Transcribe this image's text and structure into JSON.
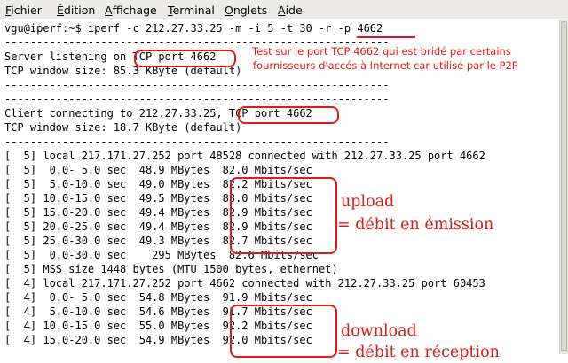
{
  "menubar": {
    "items": [
      {
        "first": "F",
        "rest": "ichier"
      },
      {
        "first": "É",
        "rest": "dition"
      },
      {
        "first": "A",
        "rest": "ffichage"
      },
      {
        "first": "T",
        "rest": "erminal"
      },
      {
        "first": "O",
        "rest": "nglets"
      },
      {
        "first": "A",
        "rest": "ide"
      }
    ]
  },
  "terminal": {
    "lines": [
      "vgu@iperf:~$ iperf -c 212.27.33.25 -m -i 5 -t 30 -r -p 4662",
      "------------------------------------------------------------",
      "Server listening on TCP port 4662",
      "TCP window size: 85.3 KByte (default)",
      "------------------------------------------------------------",
      "------------------------------------------------------------",
      "Client connecting to 212.27.33.25, TCP port 4662",
      "TCP window size: 18.7 KByte (default)",
      "------------------------------------------------------------",
      "[  5] local 217.171.27.252 port 48528 connected with 212.27.33.25 port 4662",
      "[  5]  0.0- 5.0 sec  48.9 MBytes  82.0 Mbits/sec",
      "[  5]  5.0-10.0 sec  49.0 MBytes  82.2 Mbits/sec",
      "[  5] 10.0-15.0 sec  49.5 MBytes  83.0 Mbits/sec",
      "[  5] 15.0-20.0 sec  49.4 MBytes  82.9 Mbits/sec",
      "[  5] 20.0-25.0 sec  49.4 MBytes  82.9 Mbits/sec",
      "[  5] 25.0-30.0 sec  49.3 MBytes  82.7 Mbits/sec",
      "[  5]  0.0-30.0 sec    295 MBytes  82.6 Mbits/sec",
      "[  5] MSS size 1448 bytes (MTU 1500 bytes, ethernet)",
      "[  4] local 217.171.27.252 port 4662 connected with 212.27.33.25 port 60453",
      "[  4]  0.0- 5.0 sec  54.8 MBytes  91.9 Mbits/sec",
      "[  4]  5.0-10.0 sec  54.6 MBytes  91.7 Mbits/sec",
      "[  4] 10.0-15.0 sec  55.0 MBytes  92.2 Mbits/sec",
      "[  4] 15.0-20.0 sec  54.9 MBytes  92.0 Mbits/sec"
    ]
  },
  "annotations": {
    "note_line1": "Test sur le port TCP 4662 qui est bridé par certains",
    "note_line2": "fournisseurs d'accés à Internet car utilisé par le P2P",
    "upload_line1": "upload",
    "upload_line2": "= débit en émission",
    "download_line1": "download",
    "download_line2": "= débit en réception"
  },
  "colors": {
    "annotation": "#e01818",
    "menubar_bg": "#ecebe8",
    "terminal_bg": "#ffffff"
  }
}
